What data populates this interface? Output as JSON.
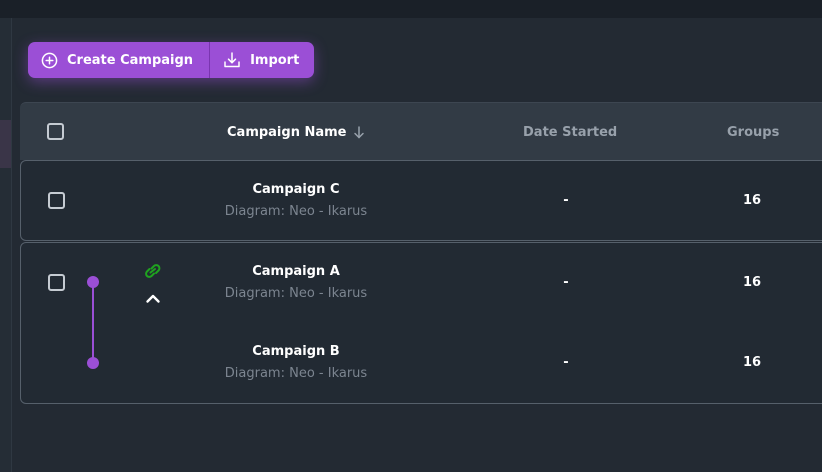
{
  "toolbar": {
    "create_label": "Create Campaign",
    "import_label": "Import",
    "create_icon": "plus-circle-icon",
    "import_icon": "download-icon"
  },
  "colors": {
    "accent": "#9b4fd6",
    "link_icon": "#1fa31f",
    "background": "#232a33",
    "header_bg": "#323b45"
  },
  "table": {
    "columns": {
      "name": "Campaign Name",
      "date": "Date Started",
      "groups": "Groups"
    },
    "sort": {
      "column": "name",
      "direction": "descending"
    },
    "rows": [
      {
        "name": "Campaign C",
        "diagram": "Diagram: Neo - Ikarus",
        "date": "-",
        "groups": "16"
      },
      {
        "name": "Campaign A",
        "diagram": "Diagram: Neo - Ikarus",
        "date": "-",
        "groups": "16",
        "linked": true
      },
      {
        "name": "Campaign B",
        "diagram": "Diagram: Neo - Ikarus",
        "date": "-",
        "groups": "16",
        "linked": true
      }
    ]
  }
}
